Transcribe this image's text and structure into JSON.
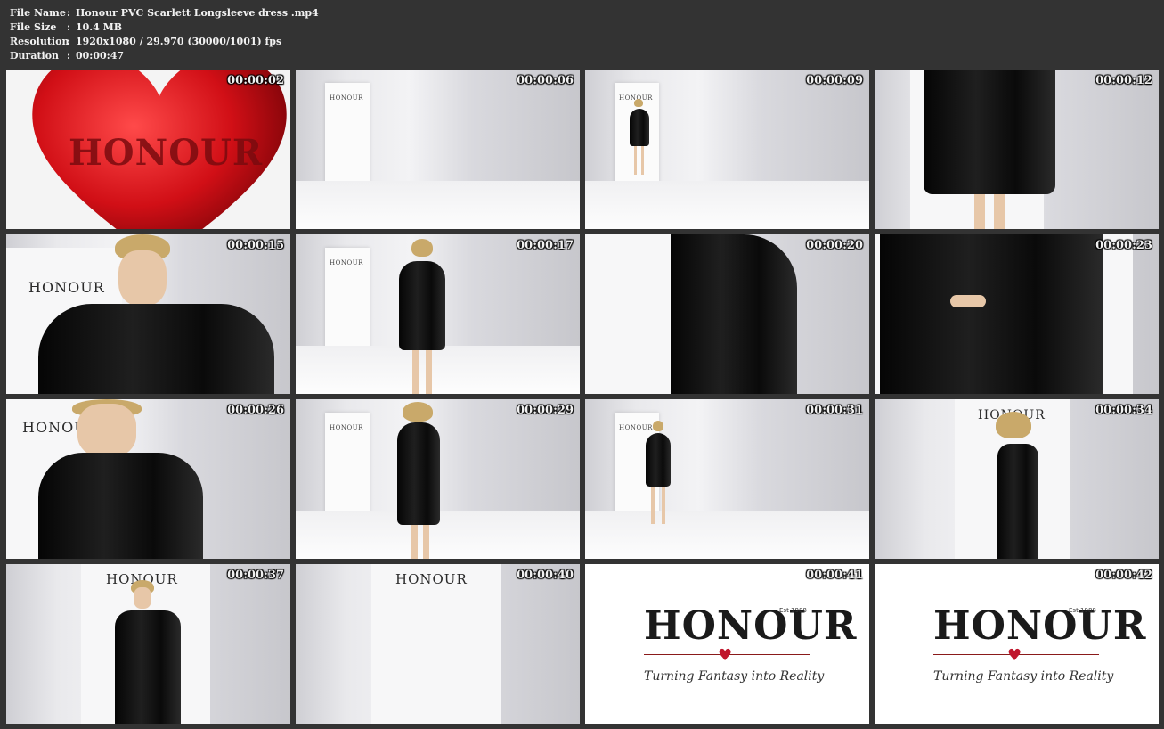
{
  "info": {
    "rows": [
      {
        "label": "File Name",
        "value": "Honour PVC Scarlett Longsleeve dress .mp4"
      },
      {
        "label": "File Size",
        "value": "10.4 MB"
      },
      {
        "label": "Resolution",
        "value": "1920x1080 / 29.970 (30000/1001) fps"
      },
      {
        "label": "Duration",
        "value": "00:00:47"
      }
    ],
    "separator": ":"
  },
  "thumbnails": [
    {
      "time": "00:00:02"
    },
    {
      "time": "00:00:06"
    },
    {
      "time": "00:00:09"
    },
    {
      "time": "00:00:12"
    },
    {
      "time": "00:00:15"
    },
    {
      "time": "00:00:17"
    },
    {
      "time": "00:00:20"
    },
    {
      "time": "00:00:23"
    },
    {
      "time": "00:00:26"
    },
    {
      "time": "00:00:29"
    },
    {
      "time": "00:00:31"
    },
    {
      "time": "00:00:34"
    },
    {
      "time": "00:00:37"
    },
    {
      "time": "00:00:40"
    },
    {
      "time": "00:00:41"
    },
    {
      "time": "00:00:42"
    }
  ],
  "brand": {
    "name": "HONOUR",
    "name_cased": "HONOUR",
    "mini": "HONOUR",
    "est": "Est 1988",
    "tagline": "Turning Fantasy into Reality"
  },
  "colors": {
    "heart": "#d10f16",
    "background": "#333333",
    "text": "#f2f2f2"
  }
}
